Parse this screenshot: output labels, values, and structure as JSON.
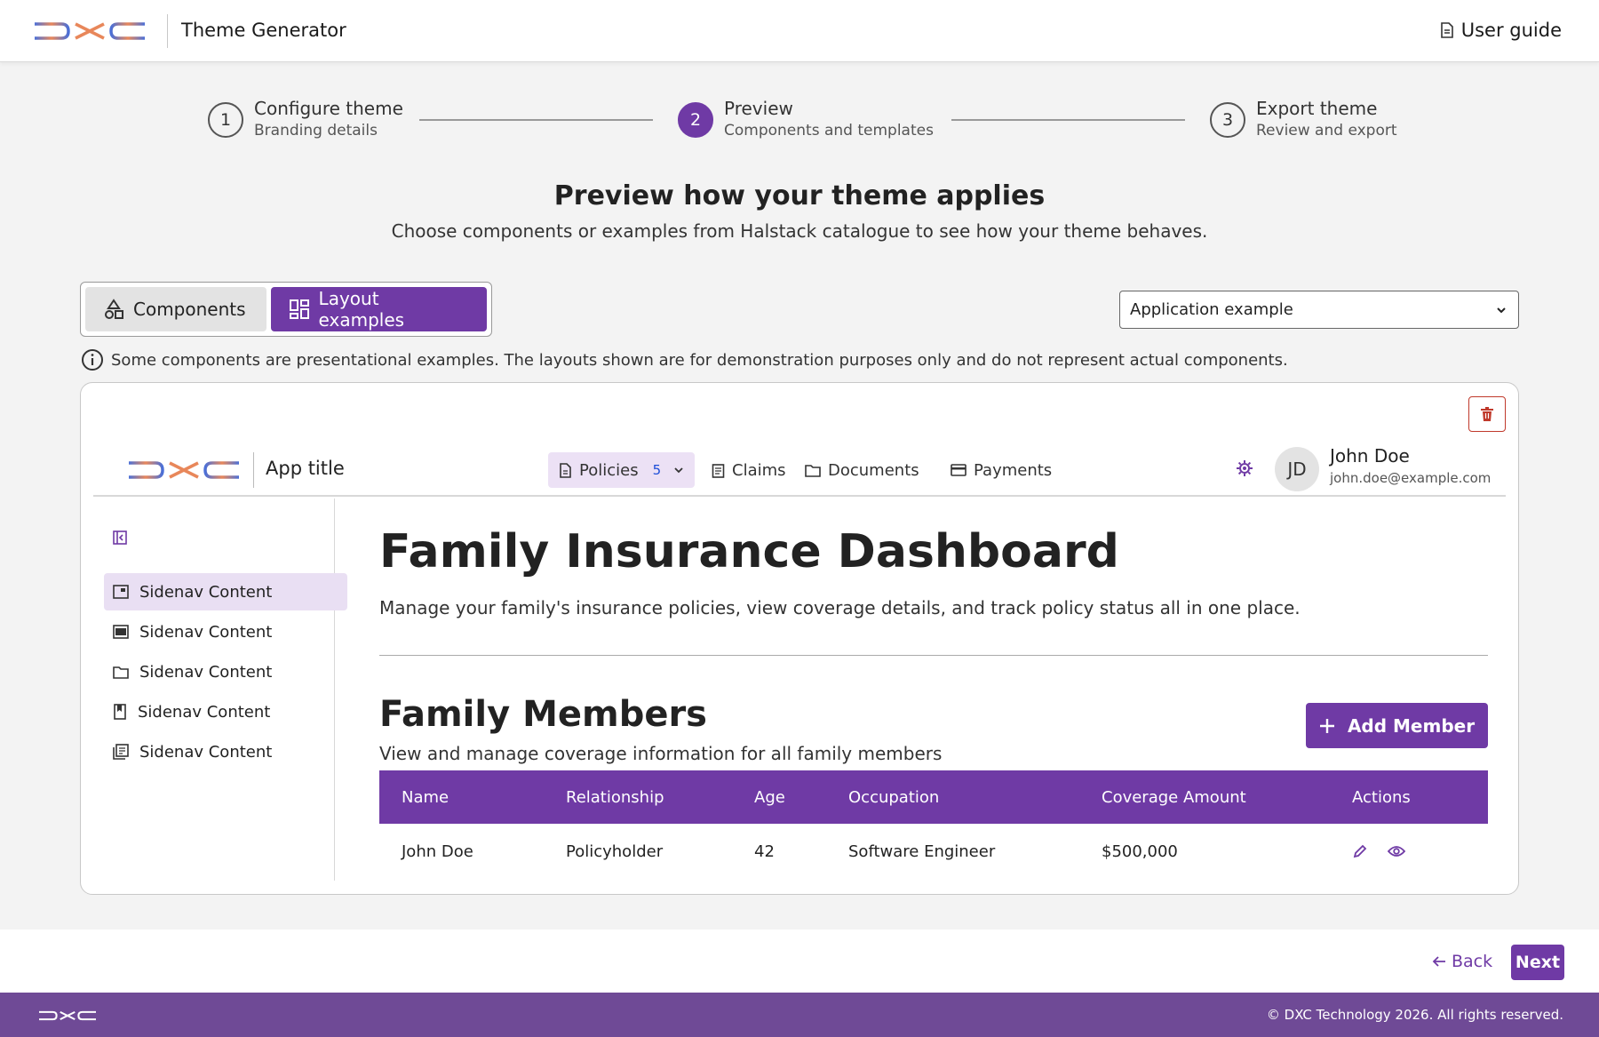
{
  "header": {
    "app_title": "Theme Generator",
    "user_guide": "User guide",
    "logo_icon": "dxc-logo"
  },
  "steps": [
    {
      "number": "1",
      "label": "Configure theme",
      "sublabel": "Branding details",
      "state": "done"
    },
    {
      "number": "2",
      "label": "Preview",
      "sublabel": "Components and templates",
      "state": "active"
    },
    {
      "number": "3",
      "label": "Export theme",
      "sublabel": "Review and export",
      "state": "pending"
    }
  ],
  "intro": {
    "title": "Preview how your theme applies",
    "subtitle": "Choose components or examples from Halstack catalogue to see how your theme behaves."
  },
  "toggle": {
    "components": "Components",
    "layout_examples": "Layout examples",
    "selected": "Layout examples"
  },
  "select": {
    "value": "Application example"
  },
  "info_note": "Some components are presentational examples. The layouts shown are for demonstration purposes only and do not represent actual components.",
  "preview": {
    "app_title": "App title",
    "nav": {
      "policies": "Policies",
      "policies_count": "5",
      "claims": "Claims",
      "documents": "Documents",
      "payments": "Payments"
    },
    "user": {
      "initials": "JD",
      "name": "John Doe",
      "email": "john.doe@example.com"
    },
    "sidenav": [
      "Sidenav Content",
      "Sidenav Content",
      "Sidenav Content",
      "Sidenav Content",
      "Sidenav Content"
    ],
    "dashboard_title": "Family Insurance Dashboard",
    "dashboard_subtitle": "Manage your family's insurance policies, view coverage details, and track policy status all in one place.",
    "members_title": "Family Members",
    "members_subtitle": "View and manage coverage information for all family members",
    "add_member": "Add Member",
    "table": {
      "headers": [
        "Name",
        "Relationship",
        "Age",
        "Occupation",
        "Coverage Amount",
        "Actions"
      ],
      "rows": [
        [
          "John Doe",
          "Policyholder",
          "42",
          "Software Engineer",
          "$500,000"
        ]
      ]
    }
  },
  "footer_nav": {
    "back": "Back",
    "next": "Next"
  },
  "footer": {
    "copyright": "© DXC Technology 2026. All rights reserved."
  },
  "colors": {
    "accent": "#6f3aa5",
    "footer": "#6f4a96",
    "danger": "#c0392b"
  }
}
